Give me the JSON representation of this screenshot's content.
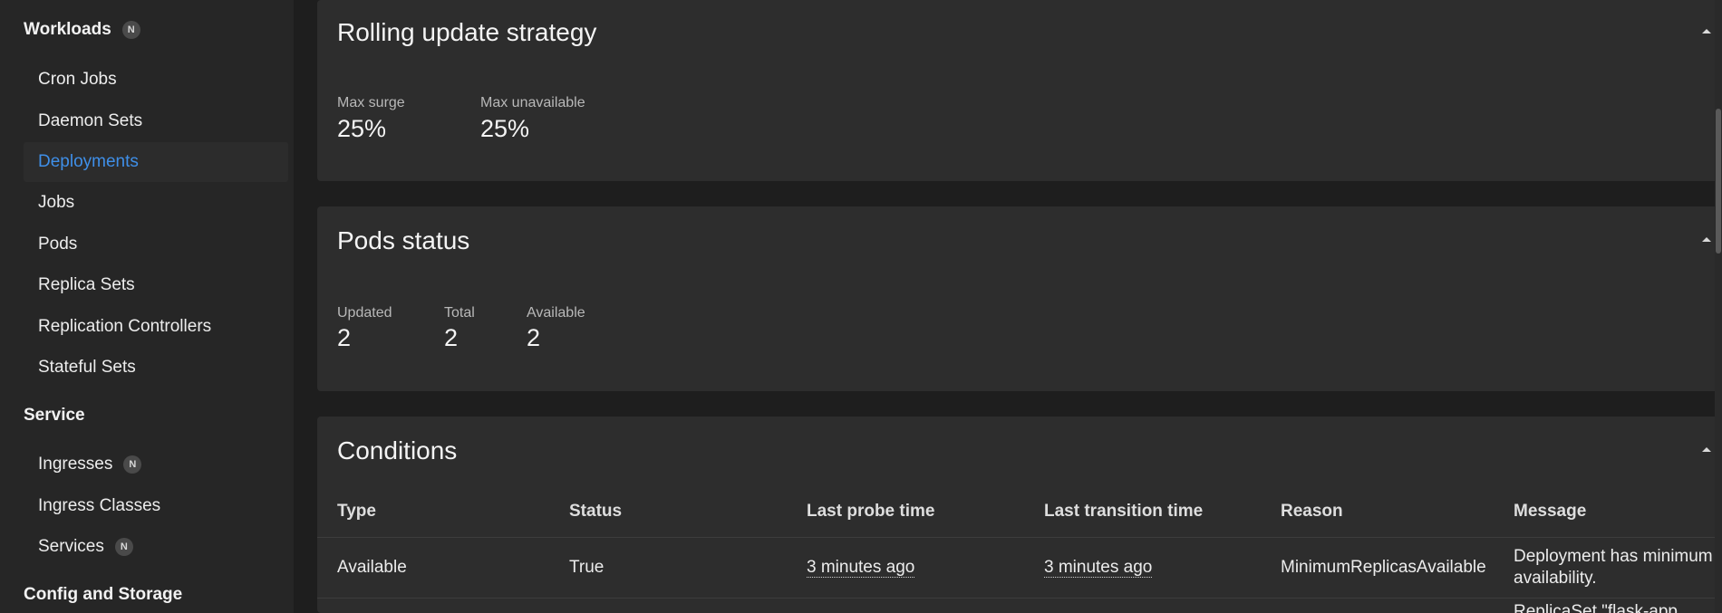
{
  "sidebar": {
    "workloads": {
      "label": "Workloads",
      "badge": "N",
      "items": [
        "Cron Jobs",
        "Daemon Sets",
        "Deployments",
        "Jobs",
        "Pods",
        "Replica Sets",
        "Replication Controllers",
        "Stateful Sets"
      ],
      "active_item": "Deployments"
    },
    "service": {
      "label": "Service",
      "items": [
        "Ingresses",
        "Ingress Classes",
        "Services"
      ],
      "ingresses_badge": "N",
      "services_badge": "N"
    },
    "config_storage": {
      "label": "Config and Storage"
    }
  },
  "rolling_update": {
    "title": "Rolling update strategy",
    "max_surge_label": "Max surge",
    "max_surge_value": "25%",
    "max_unavailable_label": "Max unavailable",
    "max_unavailable_value": "25%"
  },
  "pods_status": {
    "title": "Pods status",
    "updated_label": "Updated",
    "updated_value": "2",
    "total_label": "Total",
    "total_value": "2",
    "available_label": "Available",
    "available_value": "2"
  },
  "conditions": {
    "title": "Conditions",
    "headers": [
      "Type",
      "Status",
      "Last probe time",
      "Last transition time",
      "Reason",
      "Message"
    ],
    "rows": [
      {
        "type": "Available",
        "status": "True",
        "last_probe": "3 minutes ago",
        "last_transition": "3 minutes ago",
        "reason": "MinimumReplicasAvailable",
        "message_line1": "Deployment has minimum",
        "message_line2": "availability."
      }
    ],
    "partial_next_row_message": "ReplicaSet \"flask-app"
  },
  "colors": {
    "active_link": "#3f8fe8",
    "sidebar_bg": "#262626",
    "card_bg": "#2d2d2d",
    "page_bg": "#1e1e1e"
  }
}
